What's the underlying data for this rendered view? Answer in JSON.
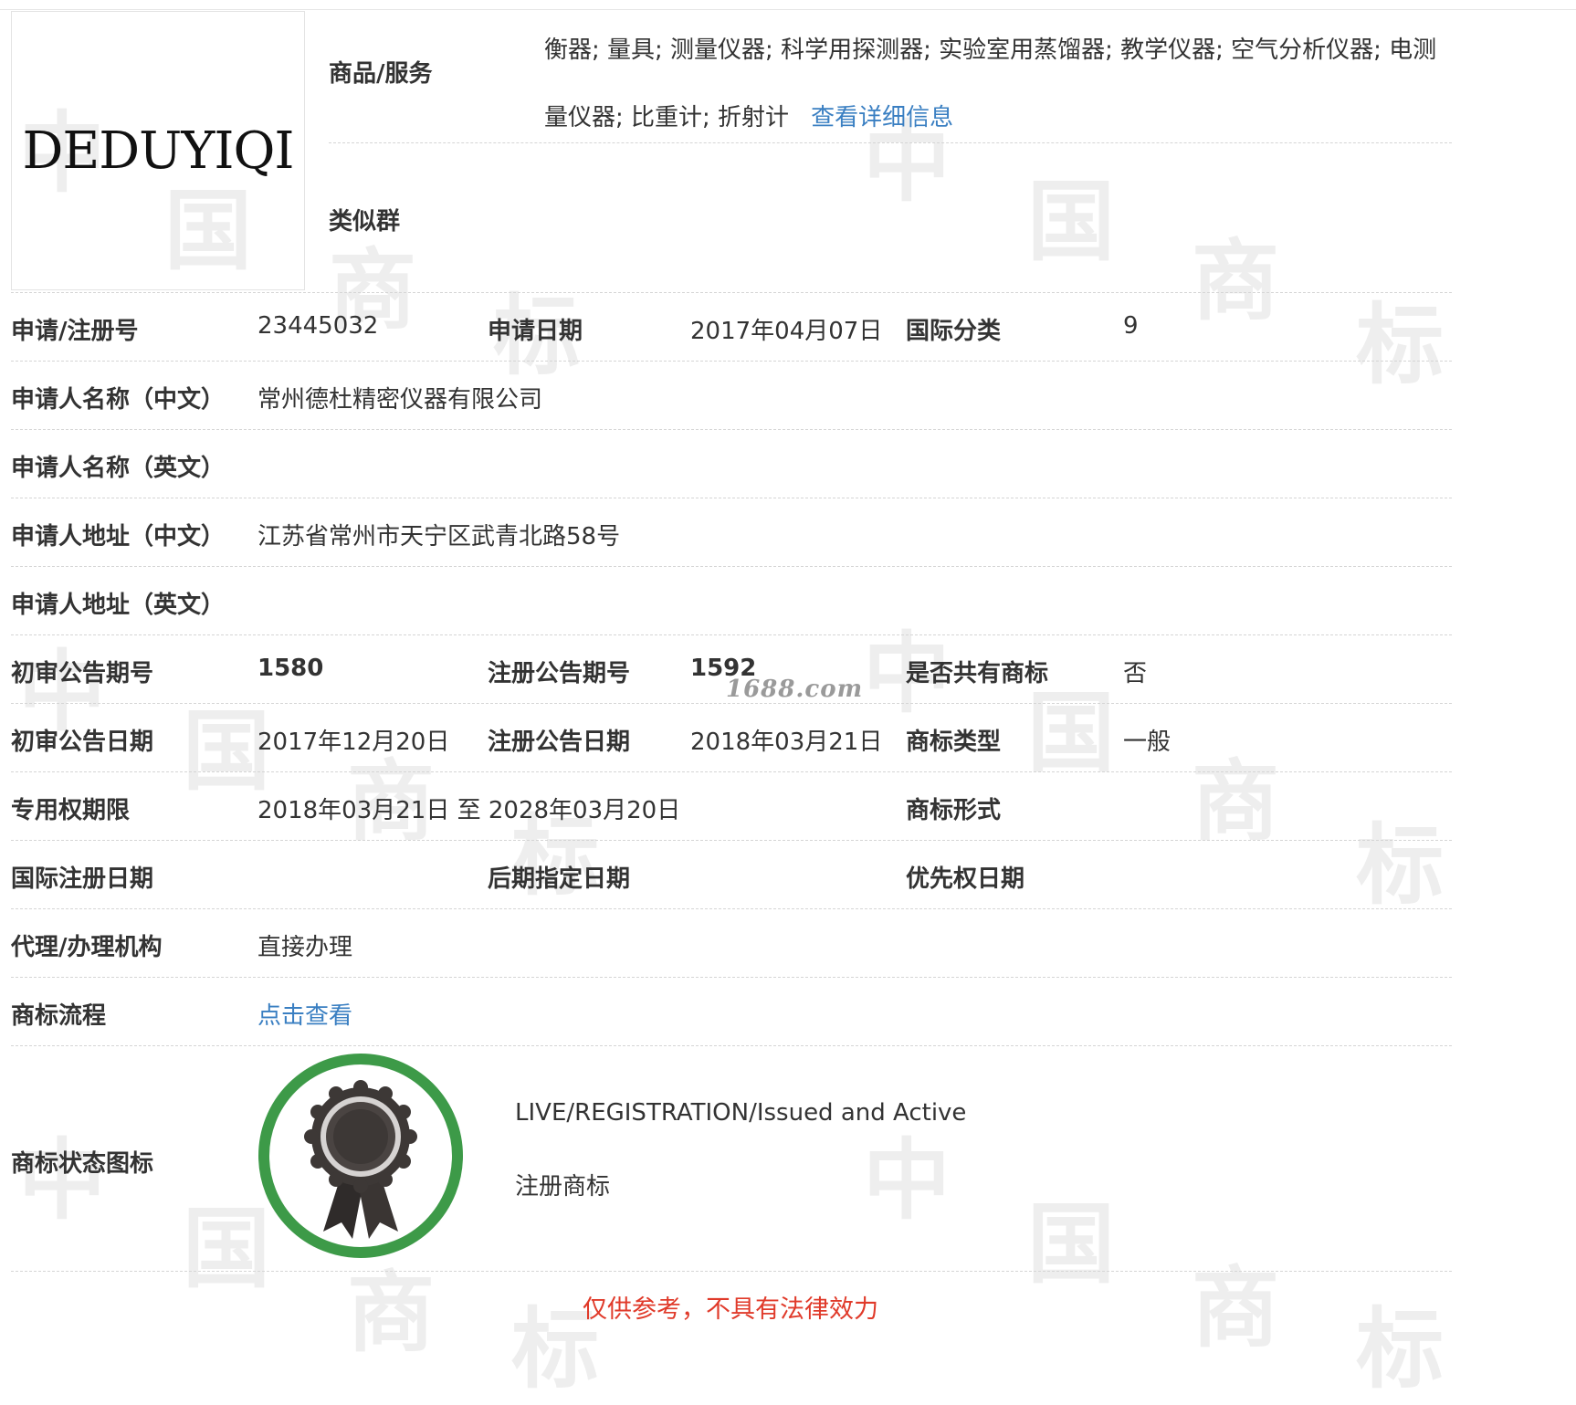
{
  "logo": {
    "text": "DEDUYIQI"
  },
  "goods": {
    "label": "商品/服务",
    "text": "衡器; 量具; 测量仪器; 科学用探测器; 实验室用蒸馏器; 教学仪器; 空气分析仪器; 电测量仪器; 比重计; 折射计",
    "detail_link": "查看详细信息"
  },
  "similar_group": {
    "label": "类似群",
    "value": ""
  },
  "rows": {
    "reg_no": {
      "label": "申请/注册号",
      "value": "23445032"
    },
    "apply_date": {
      "label": "申请日期",
      "value": "2017年04月07日"
    },
    "intl_class": {
      "label": "国际分类",
      "value": "9"
    },
    "applicant_cn": {
      "label": "申请人名称（中文）",
      "value": "常州德杜精密仪器有限公司"
    },
    "applicant_en": {
      "label": "申请人名称（英文）",
      "value": ""
    },
    "address_cn": {
      "label": "申请人地址（中文）",
      "value": "江苏省常州市天宁区武青北路58号"
    },
    "address_en": {
      "label": "申请人地址（英文）",
      "value": ""
    },
    "prelim_issue": {
      "label": "初审公告期号",
      "value": "1580"
    },
    "reg_issue": {
      "label": "注册公告期号",
      "value": "1592"
    },
    "shared_mark": {
      "label": "是否共有商标",
      "value": "否"
    },
    "prelim_date": {
      "label": "初审公告日期",
      "value": "2017年12月20日"
    },
    "reg_date": {
      "label": "注册公告日期",
      "value": "2018年03月21日"
    },
    "mark_type": {
      "label": "商标类型",
      "value": "一般"
    },
    "exclusive_period": {
      "label": "专用权期限",
      "value": "2018年03月21日 至 2028年03月20日"
    },
    "mark_form": {
      "label": "商标形式",
      "value": ""
    },
    "intl_reg_date": {
      "label": "国际注册日期",
      "value": ""
    },
    "later_designation": {
      "label": "后期指定日期",
      "value": ""
    },
    "priority_date": {
      "label": "优先权日期",
      "value": ""
    },
    "agency": {
      "label": "代理/办理机构",
      "value": "直接办理"
    },
    "process": {
      "label": "商标流程",
      "link": "点击查看"
    },
    "status_icon": {
      "label": "商标状态图标",
      "status_en": "LIVE/REGISTRATION/Issued and Active",
      "status_cn": "注册商标",
      "icon": "award-ribbon-icon",
      "ring_color": "#3d9a48"
    }
  },
  "site_watermark": "1688.com",
  "watermark_chars": [
    "中",
    "国",
    "商",
    "标"
  ],
  "disclaimer": "仅供参考，不具有法律效力",
  "colors": {
    "link": "#3a7fc2",
    "disclaimer": "#e03a2a",
    "badge_ring": "#3d9a48"
  }
}
